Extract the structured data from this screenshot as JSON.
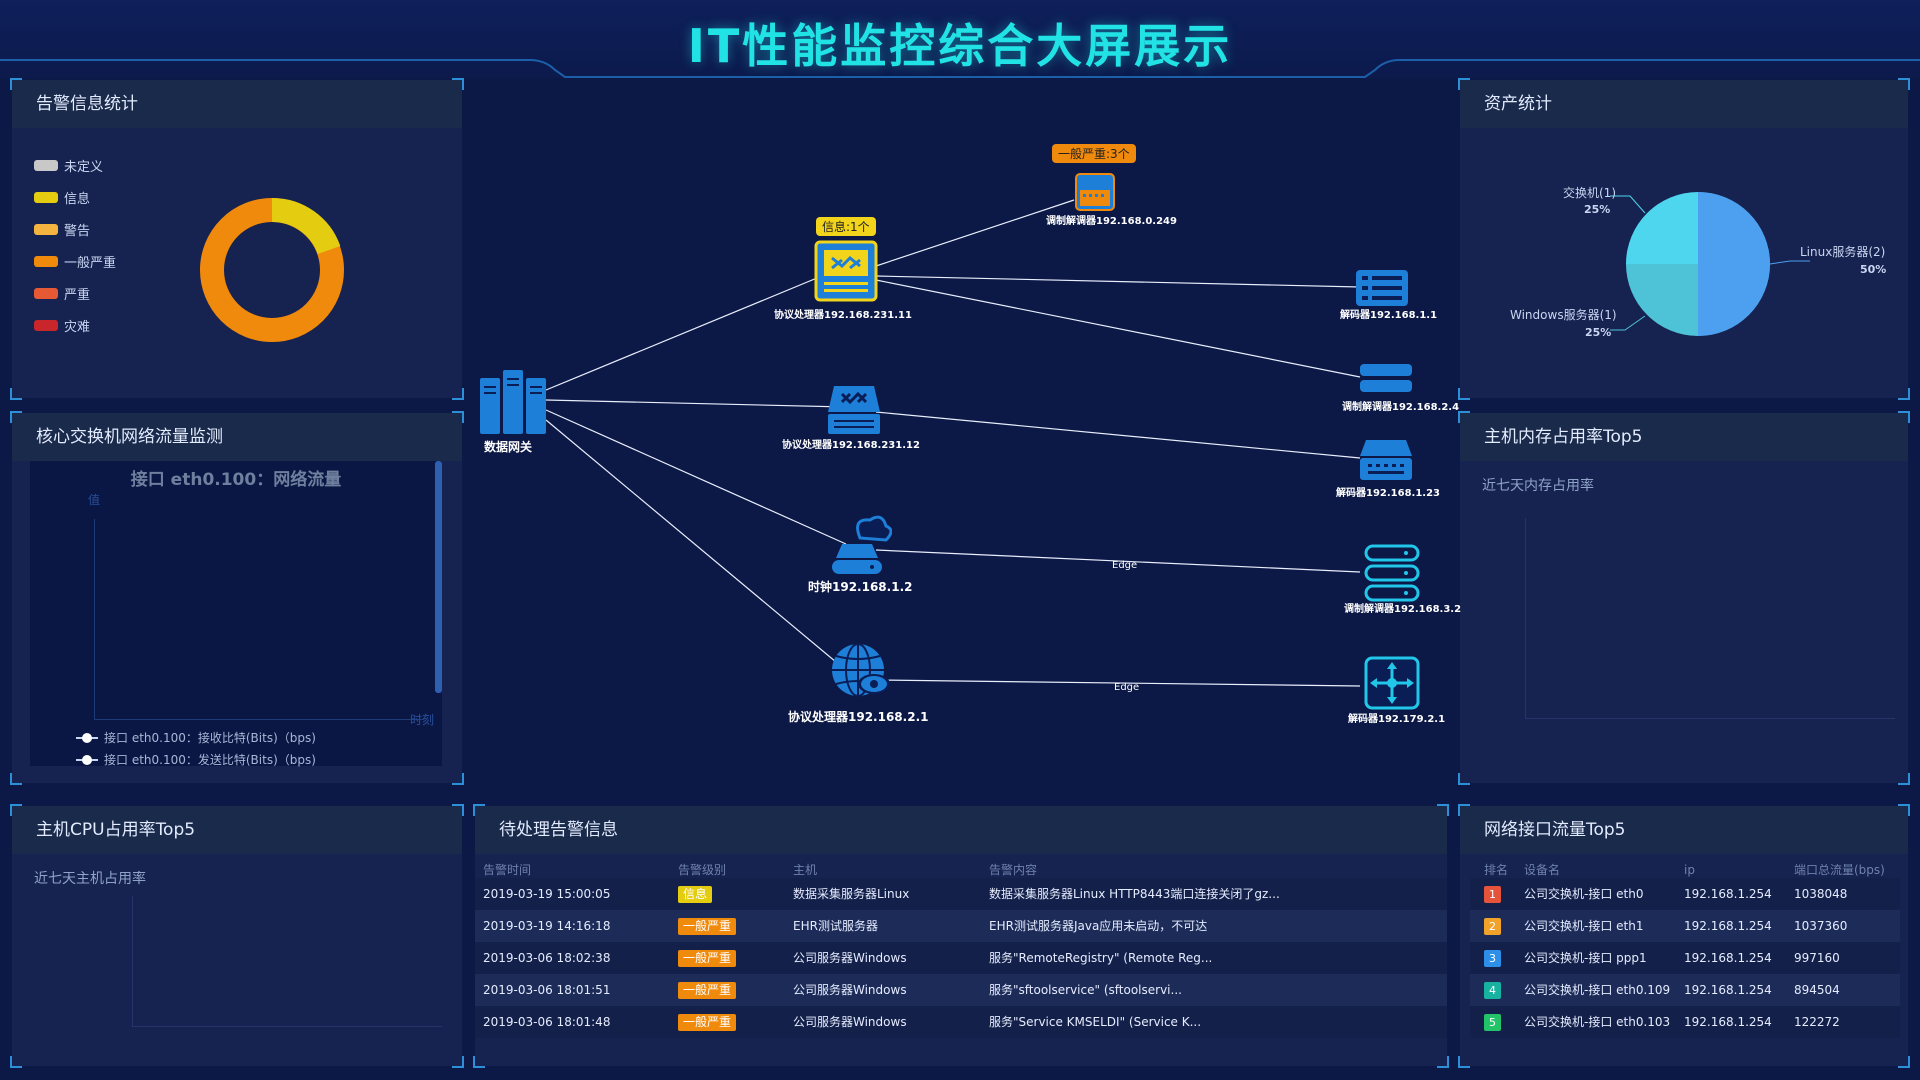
{
  "title": "IT性能监控综合大屏展示",
  "alert_stats": {
    "title": "告警信息统计",
    "legend": [
      {
        "label": "未定义",
        "color": "#c8c8c8"
      },
      {
        "label": "信息",
        "color": "#e4cc10"
      },
      {
        "label": "警告",
        "color": "#f5b340"
      },
      {
        "label": "一般严重",
        "color": "#f08a0c"
      },
      {
        "label": "严重",
        "color": "#e55934"
      },
      {
        "label": "灾难",
        "color": "#c8262a"
      }
    ]
  },
  "core_switch": {
    "title": "核心交换机网络流量监测",
    "chart_title": "接口 eth0.100：网络流量",
    "ylabel": "值",
    "xlabel": "时刻",
    "legend": [
      "接口 eth0.100：接收比特(Bits)（bps)",
      "接口 eth0.100：发送比特(Bits)（bps)"
    ]
  },
  "cpu_top5": {
    "title": "主机CPU占用率Top5",
    "subtitle": "近七天主机占用率"
  },
  "asset_stats": {
    "title": "资产统计",
    "slices": [
      {
        "label": "Linux服务器(2)",
        "pct": "50%",
        "color": "#4da0f0"
      },
      {
        "label": "Windows服务器(1)",
        "pct": "25%",
        "color": "#4ec2d6"
      },
      {
        "label": "交换机(1)",
        "pct": "25%",
        "color": "#4fd6ef"
      }
    ]
  },
  "mem_top5": {
    "title": "主机内存占用率Top5",
    "subtitle": "近七天内存占用率"
  },
  "topology": {
    "gateway": "数据网关",
    "nodes": {
      "p231_11": "协议处理器192.168.231.11",
      "p231_12": "协议处理器192.168.231.12",
      "clock": "时钟192.168.1.2",
      "p2_1": "协议处理器192.168.2.1",
      "n0_249": "调制解调器192.168.0.249",
      "n1_1": "解码器192.168.1.1",
      "n2_4": "调制解调器192.168.2.4",
      "n1_23": "解码器192.168.1.23",
      "n3_2": "调制解调器192.168.3.2",
      "n179_2": "解码器192.179.2.1"
    },
    "badges": {
      "info": "信息:1个",
      "serious": "一般严重:3个"
    },
    "edge_label": "Edge"
  },
  "pending_alerts": {
    "title": "待处理告警信息",
    "headers": [
      "告警时间",
      "告警级别",
      "主机",
      "告警内容"
    ],
    "rows": [
      {
        "time": "2019-03-19 15:00:05",
        "level": "信息",
        "level_color": "#e4cc10",
        "host": "数据采集服务器Linux",
        "content": "数据采集服务器Linux HTTP8443端口连接关闭了gz..."
      },
      {
        "time": "2019-03-19 14:16:18",
        "level": "一般严重",
        "level_color": "#f08a0c",
        "host": "EHR测试服务器",
        "content": "EHR测试服务器Java应用未启动，不可达"
      },
      {
        "time": "2019-03-06 18:02:38",
        "level": "一般严重",
        "level_color": "#f08a0c",
        "host": "公司服务器Windows",
        "content": "服务\"RemoteRegistry\" (Remote Reg..."
      },
      {
        "time": "2019-03-06 18:01:51",
        "level": "一般严重",
        "level_color": "#f08a0c",
        "host": "公司服务器Windows",
        "content": "服务\"sftoolservice\" (sftoolservi..."
      },
      {
        "time": "2019-03-06 18:01:48",
        "level": "一般严重",
        "level_color": "#f08a0c",
        "host": "公司服务器Windows",
        "content": "服务\"Service KMSELDI\" (Service K..."
      }
    ]
  },
  "net_top5": {
    "title": "网络接口流量Top5",
    "headers": [
      "排名",
      "设备名",
      "ip",
      "端口总流量(bps)"
    ],
    "rows": [
      {
        "rank": "1",
        "color": "#e5533a",
        "device": "公司交换机-接口 eth0",
        "ip": "192.168.1.254",
        "traffic": "1038048"
      },
      {
        "rank": "2",
        "color": "#f0a22a",
        "device": "公司交换机-接口 eth1",
        "ip": "192.168.1.254",
        "traffic": "1037360"
      },
      {
        "rank": "3",
        "color": "#2d8fe8",
        "device": "公司交换机-接口 ppp1",
        "ip": "192.168.1.254",
        "traffic": "997160"
      },
      {
        "rank": "4",
        "color": "#17b3a0",
        "device": "公司交换机-接口 eth0.109",
        "ip": "192.168.1.254",
        "traffic": "894504"
      },
      {
        "rank": "5",
        "color": "#23c36a",
        "device": "公司交换机-接口 eth0.103",
        "ip": "192.168.1.254",
        "traffic": "122272"
      }
    ]
  }
}
